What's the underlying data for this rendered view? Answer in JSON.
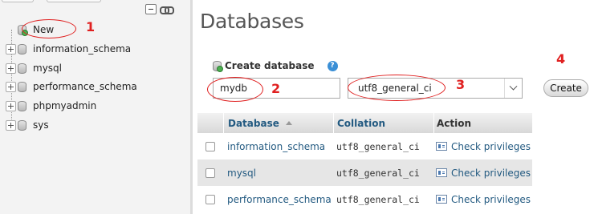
{
  "sidebar": {
    "new_label": "New",
    "databases": [
      {
        "name": "information_schema"
      },
      {
        "name": "mysql"
      },
      {
        "name": "performance_schema"
      },
      {
        "name": "phpmyadmin"
      },
      {
        "name": "sys"
      }
    ]
  },
  "main": {
    "title": "Databases",
    "create_header": "Create database",
    "help_glyph": "?",
    "db_name_value": "mydb",
    "collation_value": "utf8_general_ci",
    "create_button": "Create"
  },
  "table": {
    "headers": {
      "database": "Database",
      "collation": "Collation",
      "action": "Action"
    },
    "rows": [
      {
        "name": "information_schema",
        "collation": "utf8_general_ci",
        "action": "Check privileges"
      },
      {
        "name": "mysql",
        "collation": "utf8_general_ci",
        "action": "Check privileges"
      },
      {
        "name": "performance_schema",
        "collation": "utf8_general_ci",
        "action": "Check privileges"
      }
    ]
  },
  "annotations": [
    "1",
    "2",
    "3",
    "4"
  ],
  "colors": {
    "annotation": "#e02020",
    "link": "#235a81",
    "sidebar_bg": "#f3f3f3",
    "row_alt": "#e6e6e6"
  }
}
